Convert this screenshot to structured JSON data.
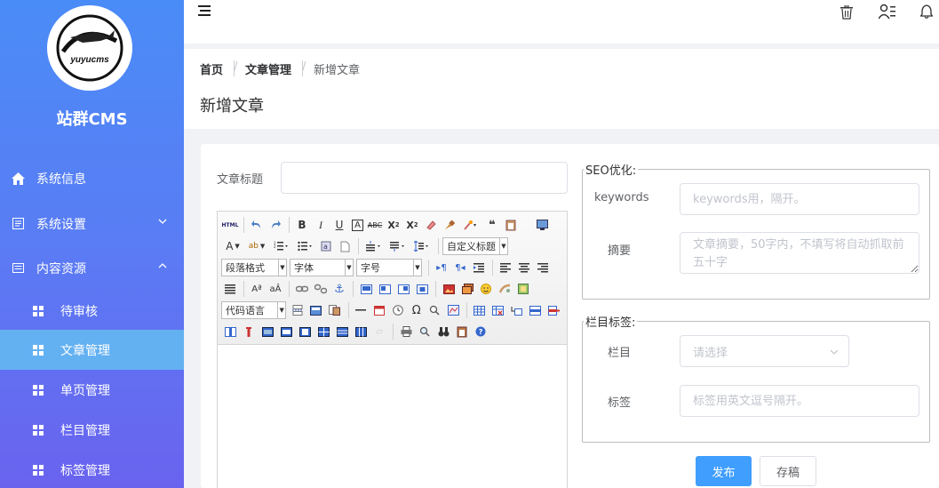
{
  "brand": {
    "name": "站群CMS",
    "logo_text": "yuyucms"
  },
  "sidebar": {
    "items": [
      {
        "label": "系统信息"
      },
      {
        "label": "系统设置"
      },
      {
        "label": "内容资源"
      }
    ],
    "sub_items": [
      {
        "label": "待审核"
      },
      {
        "label": "文章管理"
      },
      {
        "label": "单页管理"
      },
      {
        "label": "栏目管理"
      },
      {
        "label": "标签管理"
      }
    ]
  },
  "breadcrumb": {
    "home": "首页",
    "parent": "文章管理",
    "current": "新增文章",
    "separator": "/"
  },
  "page_title": "新增文章",
  "form": {
    "title_label": "文章标题",
    "title_value": "",
    "editor": {
      "custom_title": "自定义标题",
      "paragraph": "段落格式",
      "font": "字体",
      "size": "字号",
      "code_lang": "代码语言"
    },
    "seo": {
      "legend": "SEO优化:",
      "keywords_label": "keywords",
      "keywords_placeholder": "keywords用，隔开。",
      "summary_label": "摘要",
      "summary_placeholder": "文章摘要，50字内，不填写将自动抓取前五十字"
    },
    "category": {
      "legend": "栏目标签:",
      "column_label": "栏目",
      "column_placeholder": "请选择",
      "tags_label": "标签",
      "tags_placeholder": "标签用英文逗号隔开。"
    },
    "publish_label": "发布",
    "draft_label": "存稿"
  },
  "colors": {
    "primary": "#409eff",
    "sidebar_active": "#64b1f2"
  }
}
